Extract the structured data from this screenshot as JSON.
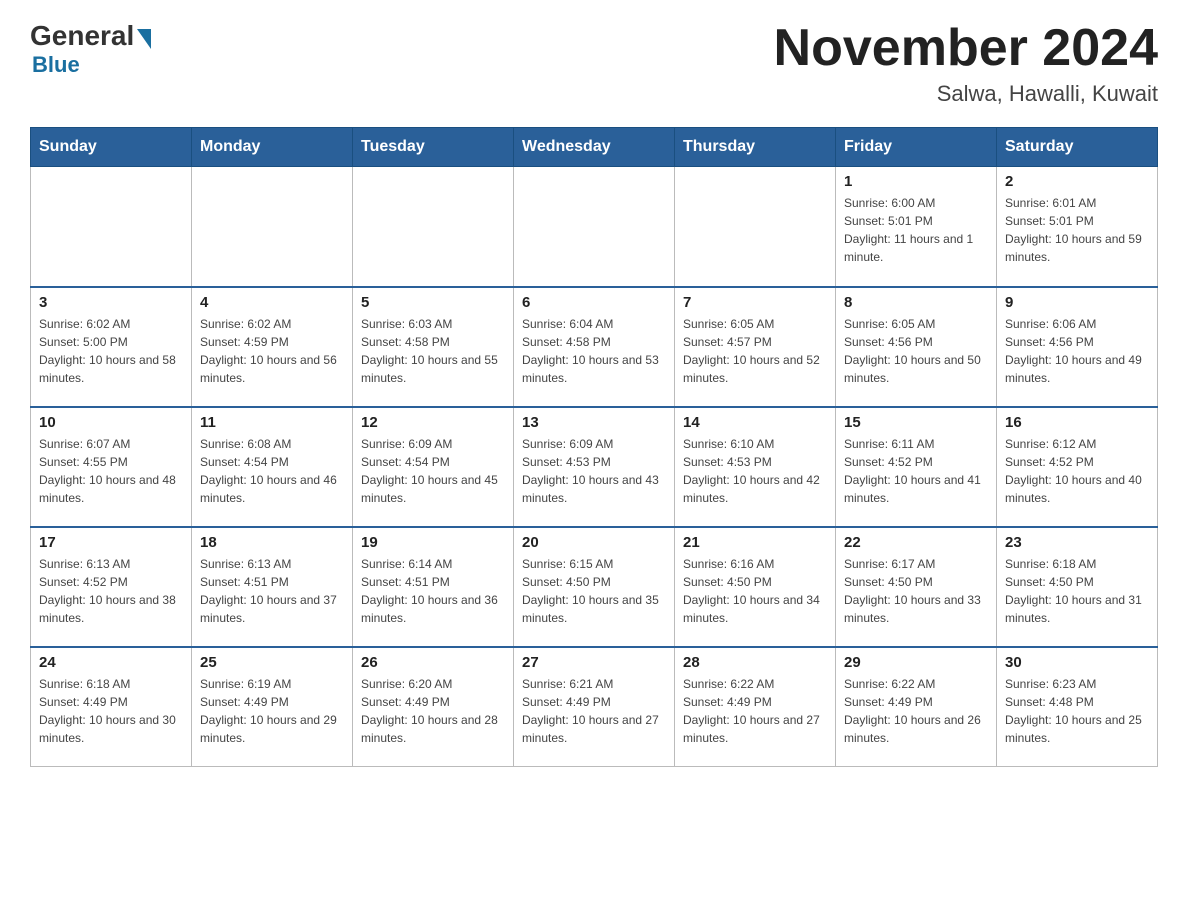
{
  "header": {
    "logo_general": "General",
    "logo_blue": "Blue",
    "month_year": "November 2024",
    "location": "Salwa, Hawalli, Kuwait"
  },
  "weekdays": [
    "Sunday",
    "Monday",
    "Tuesday",
    "Wednesday",
    "Thursday",
    "Friday",
    "Saturday"
  ],
  "weeks": [
    [
      {
        "day": "",
        "info": ""
      },
      {
        "day": "",
        "info": ""
      },
      {
        "day": "",
        "info": ""
      },
      {
        "day": "",
        "info": ""
      },
      {
        "day": "",
        "info": ""
      },
      {
        "day": "1",
        "info": "Sunrise: 6:00 AM\nSunset: 5:01 PM\nDaylight: 11 hours and 1 minute."
      },
      {
        "day": "2",
        "info": "Sunrise: 6:01 AM\nSunset: 5:01 PM\nDaylight: 10 hours and 59 minutes."
      }
    ],
    [
      {
        "day": "3",
        "info": "Sunrise: 6:02 AM\nSunset: 5:00 PM\nDaylight: 10 hours and 58 minutes."
      },
      {
        "day": "4",
        "info": "Sunrise: 6:02 AM\nSunset: 4:59 PM\nDaylight: 10 hours and 56 minutes."
      },
      {
        "day": "5",
        "info": "Sunrise: 6:03 AM\nSunset: 4:58 PM\nDaylight: 10 hours and 55 minutes."
      },
      {
        "day": "6",
        "info": "Sunrise: 6:04 AM\nSunset: 4:58 PM\nDaylight: 10 hours and 53 minutes."
      },
      {
        "day": "7",
        "info": "Sunrise: 6:05 AM\nSunset: 4:57 PM\nDaylight: 10 hours and 52 minutes."
      },
      {
        "day": "8",
        "info": "Sunrise: 6:05 AM\nSunset: 4:56 PM\nDaylight: 10 hours and 50 minutes."
      },
      {
        "day": "9",
        "info": "Sunrise: 6:06 AM\nSunset: 4:56 PM\nDaylight: 10 hours and 49 minutes."
      }
    ],
    [
      {
        "day": "10",
        "info": "Sunrise: 6:07 AM\nSunset: 4:55 PM\nDaylight: 10 hours and 48 minutes."
      },
      {
        "day": "11",
        "info": "Sunrise: 6:08 AM\nSunset: 4:54 PM\nDaylight: 10 hours and 46 minutes."
      },
      {
        "day": "12",
        "info": "Sunrise: 6:09 AM\nSunset: 4:54 PM\nDaylight: 10 hours and 45 minutes."
      },
      {
        "day": "13",
        "info": "Sunrise: 6:09 AM\nSunset: 4:53 PM\nDaylight: 10 hours and 43 minutes."
      },
      {
        "day": "14",
        "info": "Sunrise: 6:10 AM\nSunset: 4:53 PM\nDaylight: 10 hours and 42 minutes."
      },
      {
        "day": "15",
        "info": "Sunrise: 6:11 AM\nSunset: 4:52 PM\nDaylight: 10 hours and 41 minutes."
      },
      {
        "day": "16",
        "info": "Sunrise: 6:12 AM\nSunset: 4:52 PM\nDaylight: 10 hours and 40 minutes."
      }
    ],
    [
      {
        "day": "17",
        "info": "Sunrise: 6:13 AM\nSunset: 4:52 PM\nDaylight: 10 hours and 38 minutes."
      },
      {
        "day": "18",
        "info": "Sunrise: 6:13 AM\nSunset: 4:51 PM\nDaylight: 10 hours and 37 minutes."
      },
      {
        "day": "19",
        "info": "Sunrise: 6:14 AM\nSunset: 4:51 PM\nDaylight: 10 hours and 36 minutes."
      },
      {
        "day": "20",
        "info": "Sunrise: 6:15 AM\nSunset: 4:50 PM\nDaylight: 10 hours and 35 minutes."
      },
      {
        "day": "21",
        "info": "Sunrise: 6:16 AM\nSunset: 4:50 PM\nDaylight: 10 hours and 34 minutes."
      },
      {
        "day": "22",
        "info": "Sunrise: 6:17 AM\nSunset: 4:50 PM\nDaylight: 10 hours and 33 minutes."
      },
      {
        "day": "23",
        "info": "Sunrise: 6:18 AM\nSunset: 4:50 PM\nDaylight: 10 hours and 31 minutes."
      }
    ],
    [
      {
        "day": "24",
        "info": "Sunrise: 6:18 AM\nSunset: 4:49 PM\nDaylight: 10 hours and 30 minutes."
      },
      {
        "day": "25",
        "info": "Sunrise: 6:19 AM\nSunset: 4:49 PM\nDaylight: 10 hours and 29 minutes."
      },
      {
        "day": "26",
        "info": "Sunrise: 6:20 AM\nSunset: 4:49 PM\nDaylight: 10 hours and 28 minutes."
      },
      {
        "day": "27",
        "info": "Sunrise: 6:21 AM\nSunset: 4:49 PM\nDaylight: 10 hours and 27 minutes."
      },
      {
        "day": "28",
        "info": "Sunrise: 6:22 AM\nSunset: 4:49 PM\nDaylight: 10 hours and 27 minutes."
      },
      {
        "day": "29",
        "info": "Sunrise: 6:22 AM\nSunset: 4:49 PM\nDaylight: 10 hours and 26 minutes."
      },
      {
        "day": "30",
        "info": "Sunrise: 6:23 AM\nSunset: 4:48 PM\nDaylight: 10 hours and 25 minutes."
      }
    ]
  ]
}
